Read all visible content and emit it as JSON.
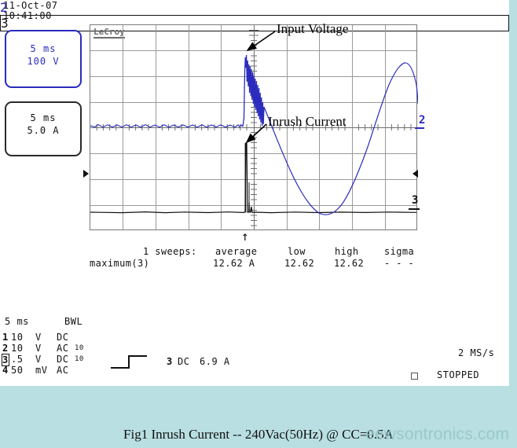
{
  "header": {
    "date": "11-Oct-07",
    "time": "10:41:00"
  },
  "channel_boxes": [
    {
      "tag": "2",
      "timebase": "5 ms",
      "scale": "100 V",
      "color": "#2b2bbd"
    },
    {
      "tag": "3",
      "timebase": "5 ms",
      "scale": "5.0 A",
      "color": "#111111"
    }
  ],
  "graticule": {
    "brand": "LeCroy",
    "columns": 10,
    "rows": 8,
    "edge_markers": [
      {
        "label": "2",
        "color": "#2b2bbd"
      },
      {
        "label": "3",
        "color": "#111111"
      }
    ]
  },
  "annotations": [
    {
      "label": "Input Voltage"
    },
    {
      "label": "Inrush Current"
    }
  ],
  "measurements": {
    "sweeps_label": "1 sweeps:",
    "columns": [
      "average",
      "low",
      "high",
      "sigma"
    ],
    "rows": [
      {
        "name": "maximum(3)",
        "average": "12.62 A",
        "low": "12.62",
        "high": "12.62",
        "sigma": "- - -"
      }
    ]
  },
  "settings": {
    "timebase": "5 ms",
    "bwl": "BWL",
    "channels": [
      {
        "num": "1",
        "value": "10",
        "unit": "V",
        "coupling": "DC",
        "probe": ""
      },
      {
        "num": "2",
        "value": "10",
        "unit": "V",
        "coupling": "AC",
        "probe": "10"
      },
      {
        "num": "3",
        "value": ".5",
        "unit": "V",
        "coupling": "DC",
        "probe": "10"
      },
      {
        "num": "4",
        "value": "50",
        "unit": "mV",
        "coupling": "AC",
        "probe": ""
      }
    ],
    "trigger": {
      "edge_icon": "rising-edge-icon",
      "source": "3",
      "coupling": "DC",
      "level": "6.9 A"
    },
    "sample_rate": "2 MS/s",
    "status": "STOPPED"
  },
  "caption": {
    "text": "Fig1  Inrush Current  -- 240Vac(50Hz) @ CC=0.5A",
    "watermark": "eewsontronics.com"
  },
  "colors": {
    "page_background": "#b9dfe2",
    "scope_background": "#ffffff",
    "trace_voltage": "#2b2bbd",
    "trace_current": "#111111",
    "grid_line": "#9a9a9a"
  }
}
